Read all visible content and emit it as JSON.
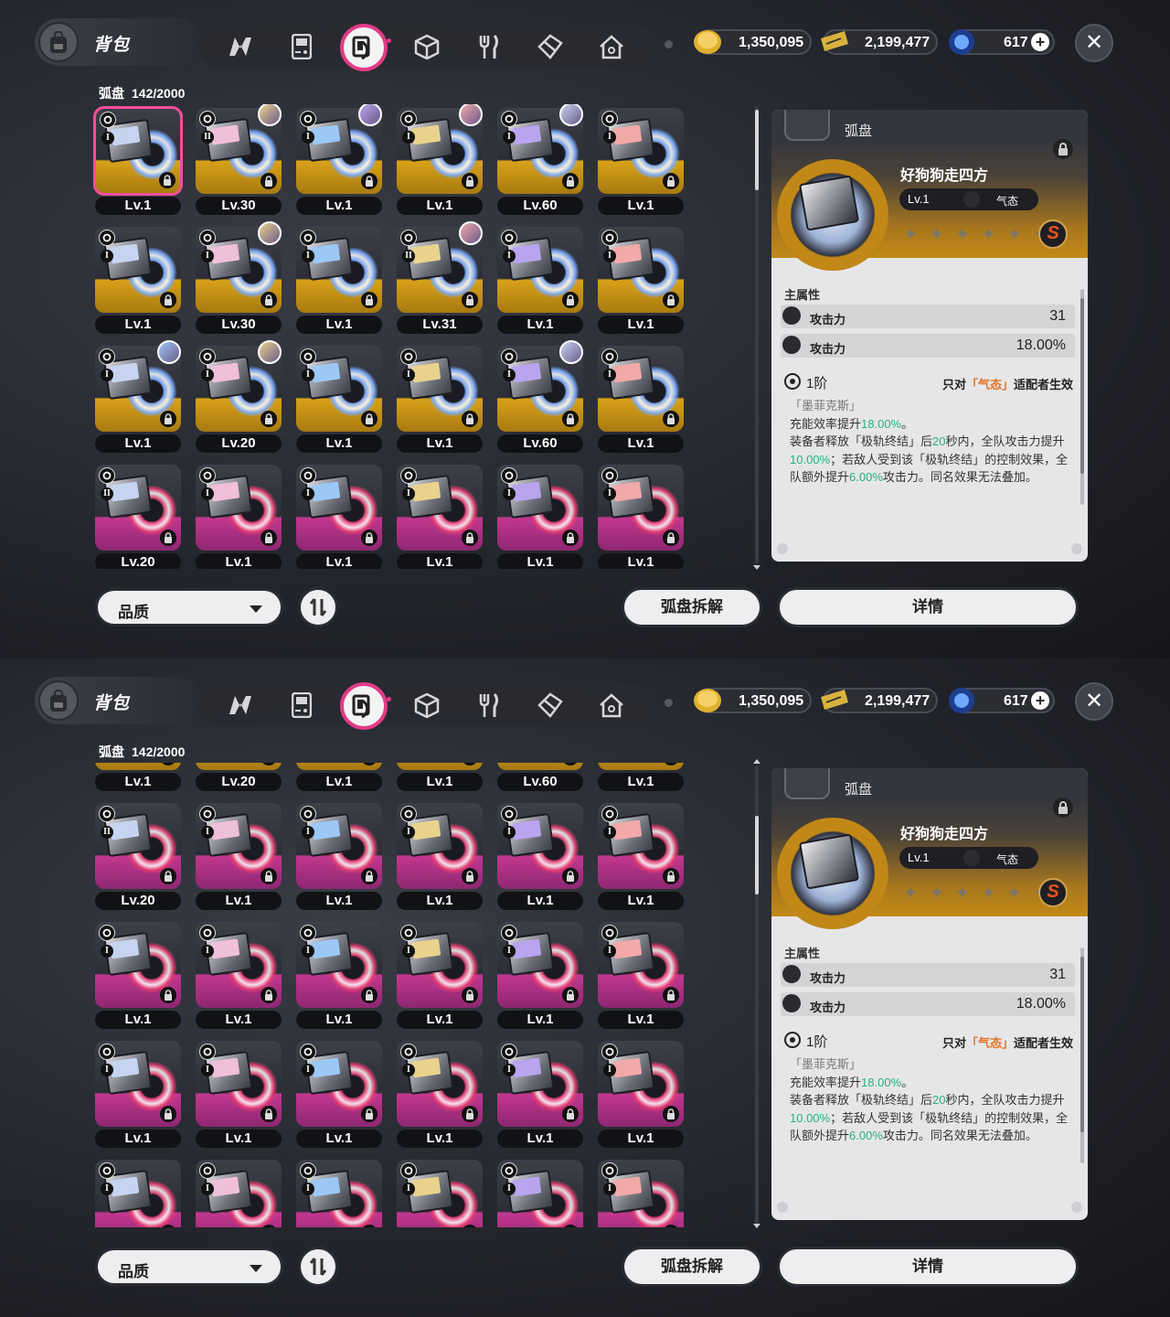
{
  "header": {
    "bag_title": "背包",
    "nav_tabs": [
      {
        "name": "tab-n",
        "icon": "n-logo-icon",
        "active": false
      },
      {
        "name": "tab-device",
        "icon": "gameboy-icon",
        "active": false
      },
      {
        "name": "tab-disc",
        "icon": "disc-sleeve-icon",
        "active": true
      },
      {
        "name": "tab-box",
        "icon": "box-icon",
        "active": false
      },
      {
        "name": "tab-food",
        "icon": "fork-knife-icon",
        "active": false
      },
      {
        "name": "tab-material",
        "icon": "crystal-icon",
        "active": false
      },
      {
        "name": "tab-home",
        "icon": "house-icon",
        "active": false
      }
    ],
    "currencies": [
      {
        "icon": "gold-coin-icon",
        "value": "1,350,095"
      },
      {
        "icon": "ticket-icon",
        "value": "2,199,477"
      },
      {
        "icon": "blue-crystal-icon",
        "value": "617"
      }
    ],
    "plus_label": "+",
    "close_label": "✕"
  },
  "inventory": {
    "label": "弧盘",
    "count": "142/2000"
  },
  "panel1_grid": [
    [
      {
        "lv": "Lv.1",
        "rar": "gold",
        "sel": true,
        "tier": "I",
        "av": false
      },
      {
        "lv": "Lv.30",
        "rar": "gold",
        "tier": "II",
        "av": true
      },
      {
        "lv": "Lv.1",
        "rar": "gold",
        "tier": "I",
        "av": true
      },
      {
        "lv": "Lv.1",
        "rar": "gold",
        "tier": "I",
        "av": true
      },
      {
        "lv": "Lv.60",
        "rar": "gold",
        "tier": "I",
        "av": true
      },
      {
        "lv": "Lv.1",
        "rar": "gold",
        "tier": "I",
        "av": false
      }
    ],
    [
      {
        "lv": "Lv.1",
        "rar": "gold",
        "tier": "I",
        "av": false
      },
      {
        "lv": "Lv.30",
        "rar": "gold",
        "tier": "I",
        "av": true
      },
      {
        "lv": "Lv.1",
        "rar": "gold",
        "tier": "I",
        "av": false
      },
      {
        "lv": "Lv.31",
        "rar": "gold",
        "tier": "II",
        "av": true
      },
      {
        "lv": "Lv.1",
        "rar": "gold",
        "tier": "I",
        "av": false
      },
      {
        "lv": "Lv.1",
        "rar": "gold",
        "tier": "I",
        "av": false
      }
    ],
    [
      {
        "lv": "Lv.1",
        "rar": "gold",
        "tier": "I",
        "av": true
      },
      {
        "lv": "Lv.20",
        "rar": "gold",
        "tier": "I",
        "av": true
      },
      {
        "lv": "Lv.1",
        "rar": "gold",
        "tier": "I",
        "av": false
      },
      {
        "lv": "Lv.1",
        "rar": "gold",
        "tier": "I",
        "av": false
      },
      {
        "lv": "Lv.60",
        "rar": "gold",
        "tier": "I",
        "av": true
      },
      {
        "lv": "Lv.1",
        "rar": "gold",
        "tier": "I",
        "av": false
      }
    ],
    [
      {
        "lv": "Lv.20",
        "rar": "pink",
        "tier": "II",
        "av": false
      },
      {
        "lv": "Lv.1",
        "rar": "pink",
        "tier": "I",
        "av": false
      },
      {
        "lv": "Lv.1",
        "rar": "pink",
        "tier": "I",
        "av": false
      },
      {
        "lv": "Lv.1",
        "rar": "pink",
        "tier": "I",
        "av": false
      },
      {
        "lv": "Lv.1",
        "rar": "pink",
        "tier": "I",
        "av": false
      },
      {
        "lv": "Lv.1",
        "rar": "pink",
        "tier": "I",
        "av": false
      }
    ]
  ],
  "panel2_grid": [
    [
      {
        "lv": "Lv.1",
        "rar": "gold",
        "tier": "I",
        "av": false
      },
      {
        "lv": "Lv.20",
        "rar": "gold",
        "tier": "I",
        "av": false
      },
      {
        "lv": "Lv.1",
        "rar": "gold",
        "tier": "I",
        "av": false
      },
      {
        "lv": "Lv.1",
        "rar": "gold",
        "tier": "I",
        "av": false
      },
      {
        "lv": "Lv.60",
        "rar": "gold",
        "tier": "I",
        "av": false
      },
      {
        "lv": "Lv.1",
        "rar": "gold",
        "tier": "I",
        "av": false
      }
    ],
    [
      {
        "lv": "Lv.20",
        "rar": "pink",
        "tier": "II",
        "av": false
      },
      {
        "lv": "Lv.1",
        "rar": "pink",
        "tier": "I",
        "av": false
      },
      {
        "lv": "Lv.1",
        "rar": "pink",
        "tier": "I",
        "av": false
      },
      {
        "lv": "Lv.1",
        "rar": "pink",
        "tier": "I",
        "av": false
      },
      {
        "lv": "Lv.1",
        "rar": "pink",
        "tier": "I",
        "av": false
      },
      {
        "lv": "Lv.1",
        "rar": "pink",
        "tier": "I",
        "av": false
      }
    ],
    [
      {
        "lv": "Lv.1",
        "rar": "pink",
        "tier": "I",
        "av": false
      },
      {
        "lv": "Lv.1",
        "rar": "pink",
        "tier": "I",
        "av": false
      },
      {
        "lv": "Lv.1",
        "rar": "pink",
        "tier": "I",
        "av": false
      },
      {
        "lv": "Lv.1",
        "rar": "pink",
        "tier": "I",
        "av": false
      },
      {
        "lv": "Lv.1",
        "rar": "pink",
        "tier": "I",
        "av": false
      },
      {
        "lv": "Lv.1",
        "rar": "pink",
        "tier": "I",
        "av": false
      }
    ],
    [
      {
        "lv": "Lv.1",
        "rar": "pink",
        "tier": "I",
        "av": false
      },
      {
        "lv": "Lv.1",
        "rar": "pink",
        "tier": "I",
        "av": false
      },
      {
        "lv": "Lv.1",
        "rar": "pink",
        "tier": "I",
        "av": false
      },
      {
        "lv": "Lv.1",
        "rar": "pink",
        "tier": "I",
        "av": false
      },
      {
        "lv": "Lv.1",
        "rar": "pink",
        "tier": "I",
        "av": false
      },
      {
        "lv": "Lv.1",
        "rar": "pink",
        "tier": "I",
        "av": false
      }
    ],
    [
      {
        "lv": "",
        "rar": "pink",
        "tier": "I",
        "av": false
      },
      {
        "lv": "",
        "rar": "pink",
        "tier": "I",
        "av": false
      },
      {
        "lv": "",
        "rar": "pink",
        "tier": "I",
        "av": false
      },
      {
        "lv": "",
        "rar": "pink",
        "tier": "I",
        "av": false
      },
      {
        "lv": "",
        "rar": "pink",
        "tier": "I",
        "av": false
      },
      {
        "lv": "",
        "rar": "pink",
        "tier": "I",
        "av": false
      }
    ]
  ],
  "controls": {
    "quality_label": "品质",
    "dismantle_label": "弧盘拆解",
    "details_label": "详情"
  },
  "detail": {
    "category": "弧盘",
    "name": "好狗狗走四方",
    "level": "Lv.1",
    "attribute": "气态",
    "stars": "✦ ✦ ✦ ✦ ✦ ✦",
    "rank_badge": "S",
    "main_attr_title": "主属性",
    "stats": [
      {
        "name": "攻击力",
        "value": "31"
      },
      {
        "name": "攻击力",
        "value": "18.00%"
      }
    ],
    "tier_label": "1阶",
    "applies_prefix": "只对",
    "applies_highlight": "「气态」",
    "applies_suffix": "适配者生效",
    "set_name": "「墨菲克斯」",
    "desc_1a": "充能效率提升",
    "desc_1b": "18.00%",
    "desc_1c": "。",
    "desc_2a": "装备者释放「极轨终结」后",
    "desc_2b": "20",
    "desc_2c": "秒内，全队攻击力提升",
    "desc_2d": "10.00%",
    "desc_2e": "；若敌人受到该「极轨终结」的控制效果，全队额外提升",
    "desc_2f": "6.00%",
    "desc_2g": "攻击力。同名效果无法叠加。"
  },
  "colors": {
    "accent_pink": "#e33b86",
    "rarity_gold": "#d9a11a",
    "rarity_pink": "#c2378f",
    "highlight_orange": "#e0742a",
    "highlight_green": "#26b07c"
  }
}
